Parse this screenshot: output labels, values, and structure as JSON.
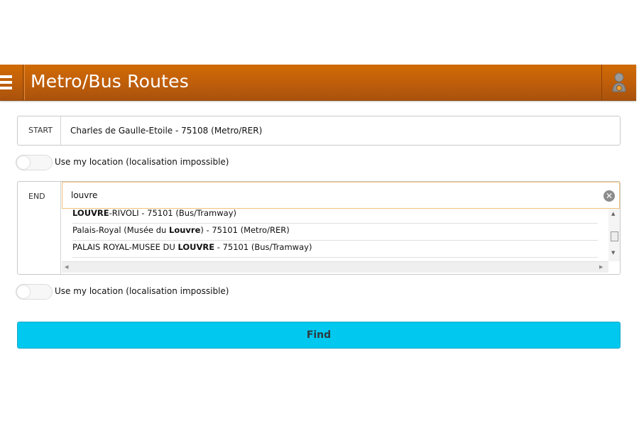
{
  "header": {
    "title": "Metro/Bus Routes",
    "menu_icon": "hamburger-menu-icon",
    "user_icon": "user-profile-icon"
  },
  "start": {
    "label": "START",
    "value": "Charles de Gaulle-Etoile - 75108 (Metro/RER)"
  },
  "start_location_toggle": {
    "label": "Use my location (localisation impossible)",
    "on": false
  },
  "end": {
    "label": "END",
    "value": "louvre",
    "clear_icon": "clear-x-icon"
  },
  "suggestions": [
    {
      "prefix": "",
      "bold": "LOUVRE",
      "suffix": "-RIVOLI - 75101 (Bus/Tramway)"
    },
    {
      "prefix": "Palais-Royal (Musée du ",
      "bold": "Louvre",
      "suffix": ") - 75101 (Metro/RER)"
    },
    {
      "prefix": "PALAIS ROYAL-MUSEE DU ",
      "bold": "LOUVRE",
      "suffix": " - 75101 (Bus/Tramway)"
    }
  ],
  "end_location_toggle": {
    "label": "Use my location (localisation impossible)",
    "on": false
  },
  "find_button": {
    "label": "Find"
  },
  "colors": {
    "header_orange": "#c2600a",
    "find_cyan": "#00c8ef",
    "input_focus_border": "#f0c27a"
  }
}
